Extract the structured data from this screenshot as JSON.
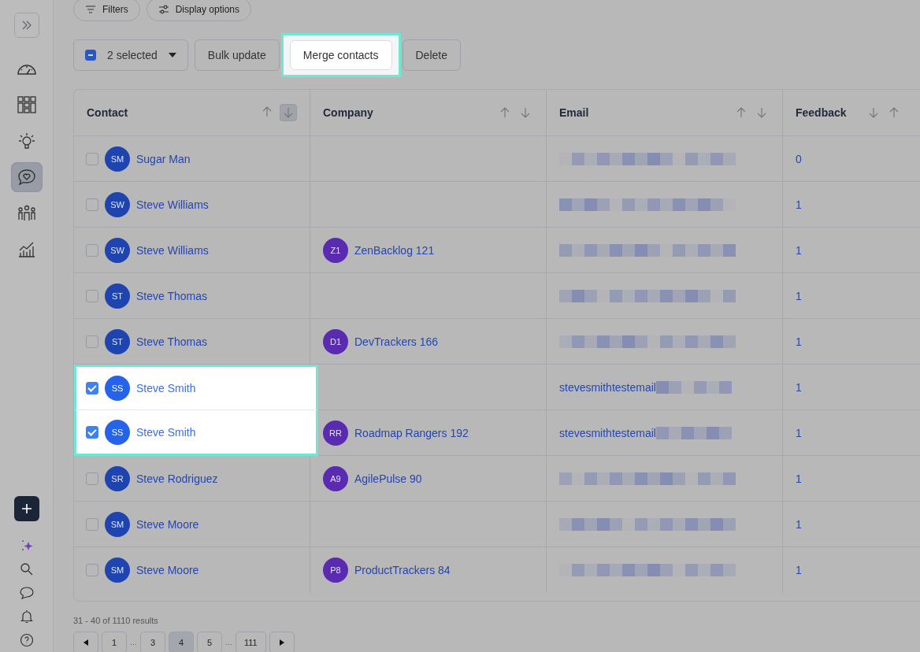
{
  "sidebar": {
    "top_items": [
      {
        "kind": "gauge",
        "selected": false
      },
      {
        "kind": "grid",
        "selected": false
      },
      {
        "kind": "bulb",
        "selected": false
      },
      {
        "kind": "chat-heart",
        "selected": true
      },
      {
        "kind": "people",
        "selected": false
      },
      {
        "kind": "chart",
        "selected": false
      }
    ],
    "bottom_items": [
      {
        "kind": "plus"
      },
      {
        "kind": "sparkle"
      },
      {
        "kind": "search"
      },
      {
        "kind": "chat"
      },
      {
        "kind": "bell"
      },
      {
        "kind": "help"
      }
    ]
  },
  "filter_bar": [
    {
      "kind": "filter",
      "label": "Filters"
    },
    {
      "kind": "sliders",
      "label": "Display options"
    }
  ],
  "bulk_bar": {
    "selection": {
      "label": "2 selected",
      "partial": true
    },
    "buttons": [
      {
        "label": "Bulk update",
        "highlighted": false
      },
      {
        "label": "Merge contacts",
        "highlighted": true
      },
      {
        "label": "Delete",
        "highlighted": false
      }
    ]
  },
  "table": {
    "columns": [
      {
        "label": "Contact",
        "arrows_reversed": false,
        "sorted_descending": true
      },
      {
        "label": "Company",
        "arrows_reversed": false,
        "sorted_descending": false
      },
      {
        "label": "Email",
        "arrows_reversed": false,
        "sorted_descending": false
      },
      {
        "label": "Feedback",
        "arrows_reversed": true,
        "sorted_descending": false
      }
    ],
    "rows": [
      {
        "initials": "SM",
        "name": "Sugar Man",
        "checked": false,
        "email_masked": true,
        "feedback": "0"
      },
      {
        "initials": "SW",
        "name": "Steve Williams",
        "checked": false,
        "email_masked": true,
        "feedback": "1"
      },
      {
        "initials": "SW",
        "name": "Steve Williams",
        "checked": false,
        "company": {
          "initials": "Z1",
          "name": "ZenBacklog 121"
        },
        "email_masked": true,
        "feedback": "1"
      },
      {
        "initials": "ST",
        "name": "Steve Thomas",
        "checked": false,
        "email_masked": true,
        "feedback": "1"
      },
      {
        "initials": "ST",
        "name": "Steve Thomas",
        "checked": false,
        "company": {
          "initials": "D1",
          "name": "DevTrackers 166"
        },
        "email_masked": true,
        "feedback": "1"
      },
      {
        "initials": "SS",
        "name": "Steve Smith",
        "checked": true,
        "email": "stevesmithtestemail",
        "email_masked": true,
        "feedback": "1"
      },
      {
        "initials": "SS",
        "name": "Steve Smith",
        "checked": true,
        "company": {
          "initials": "RR",
          "name": "Roadmap Rangers 192"
        },
        "email": "stevesmithtestemail",
        "email_masked": true,
        "feedback": "1"
      },
      {
        "initials": "SR",
        "name": "Steve Rodriguez",
        "checked": false,
        "company": {
          "initials": "A9",
          "name": "AgilePulse 90"
        },
        "email_masked": true,
        "feedback": "1"
      },
      {
        "initials": "SM",
        "name": "Steve Moore",
        "checked": false,
        "email_masked": true,
        "feedback": "1"
      },
      {
        "initials": "SM",
        "name": "Steve Moore",
        "checked": false,
        "company": {
          "initials": "P8",
          "name": "ProductTrackers 84"
        },
        "email_masked": true,
        "feedback": "1"
      }
    ]
  },
  "results": "31 - 40 of 1110 results",
  "pagination": [
    {
      "kind": "prev"
    },
    {
      "kind": "page",
      "label": "1",
      "selected": false
    },
    {
      "kind": "gap",
      "label": "…"
    },
    {
      "kind": "page",
      "label": "3",
      "selected": false
    },
    {
      "kind": "page",
      "label": "4",
      "selected": true
    },
    {
      "kind": "page",
      "label": "5",
      "selected": false
    },
    {
      "kind": "gap",
      "label": "…"
    },
    {
      "kind": "page",
      "label": "111",
      "selected": false
    },
    {
      "kind": "next"
    }
  ]
}
